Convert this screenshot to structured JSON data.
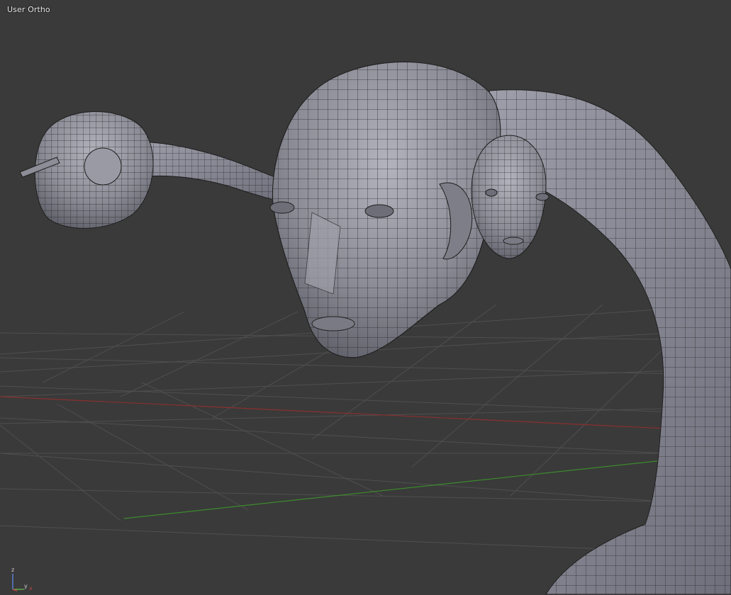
{
  "viewport": {
    "label": "User Ortho",
    "grid_color": "#4f4f4f",
    "x_axis_color": "#8a2f2f",
    "y_axis_color": "#3c8a2c",
    "mesh_fill": "#8e8e99",
    "mesh_wire": "#1c1c1c",
    "background": "#3a3a3a"
  },
  "axis_gizmo": {
    "z_label": "z",
    "y_label": "y",
    "x_label": "x"
  }
}
